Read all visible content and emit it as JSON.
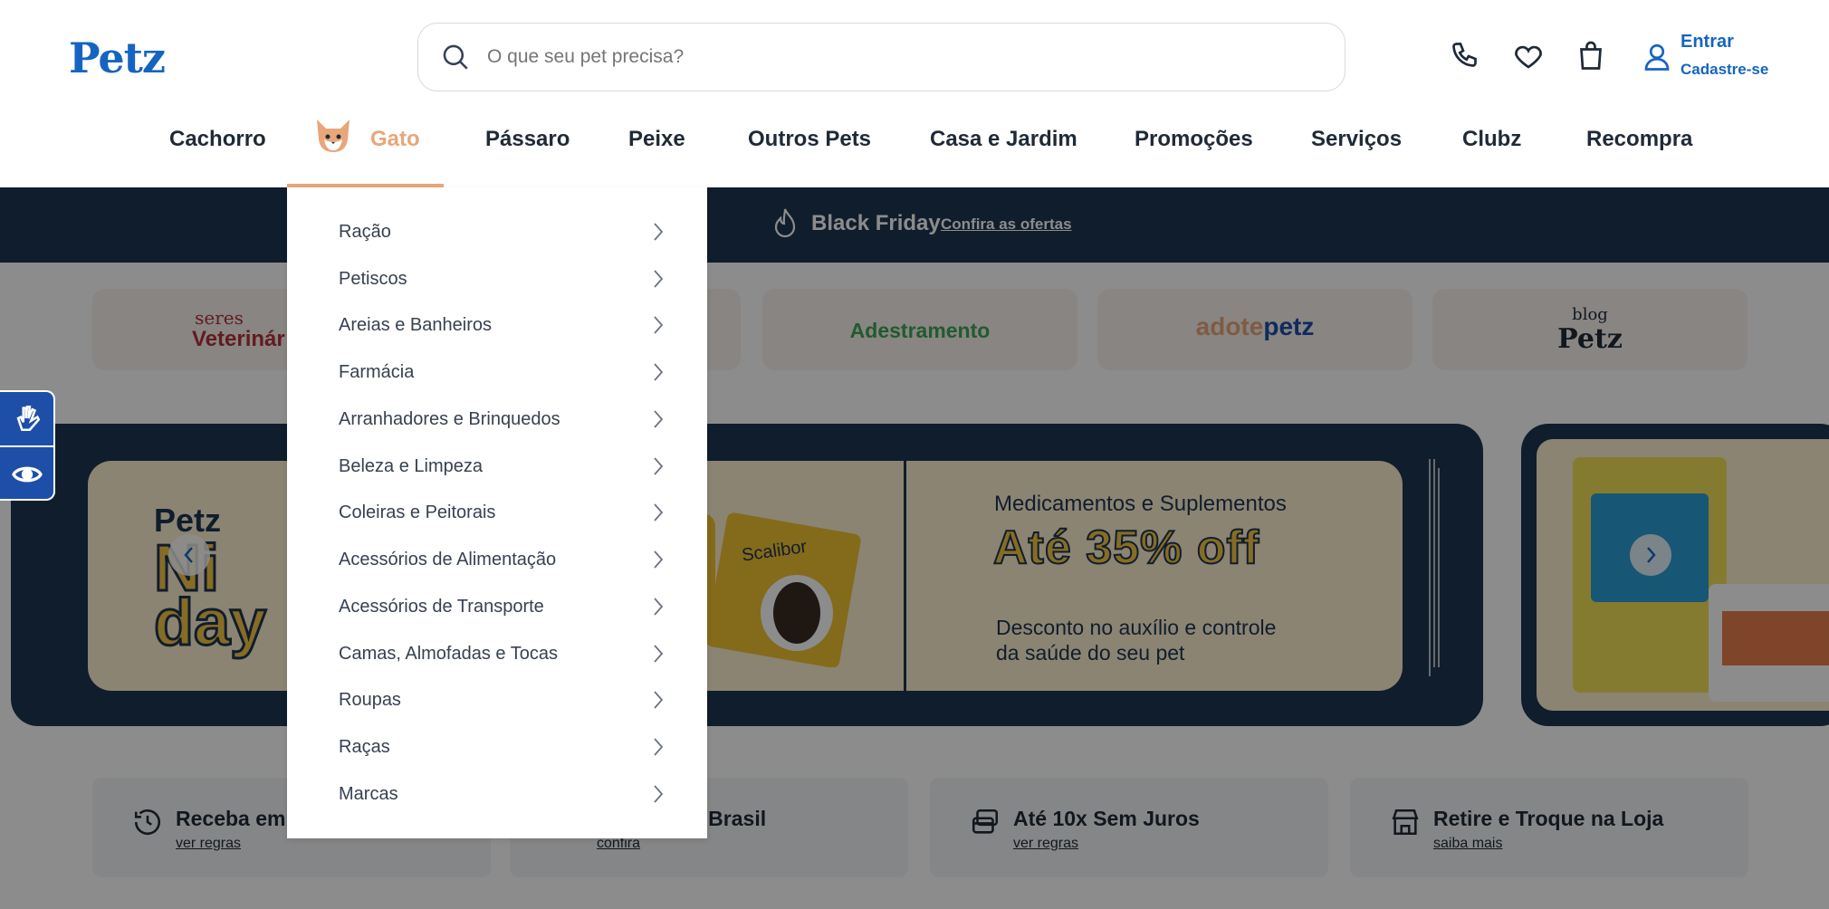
{
  "header": {
    "search_placeholder": "O que seu pet precisa?",
    "login_label": "Entrar",
    "signup_label": "Cadastre-se"
  },
  "nav": {
    "items": [
      {
        "label": "Cachorro"
      },
      {
        "label": "Gato"
      },
      {
        "label": "Pássaro"
      },
      {
        "label": "Peixe"
      },
      {
        "label": "Outros Pets"
      },
      {
        "label": "Casa e Jardim"
      },
      {
        "label": "Promoções"
      },
      {
        "label": "Serviços"
      },
      {
        "label": "Clubz"
      },
      {
        "label": "Recompra"
      }
    ],
    "active": "Gato"
  },
  "dropdown": {
    "items": [
      "Ração",
      "Petiscos",
      "Areias e Banheiros",
      "Farmácia",
      "Arranhadores e Brinquedos",
      "Beleza e Limpeza",
      "Coleiras e Peitorais",
      "Acessórios de Alimentação",
      "Acessórios de Transporte",
      "Camas, Almofadas e Tocas",
      "Roupas",
      "Raças",
      "Marcas"
    ]
  },
  "promo_bar": {
    "title": "Black Friday",
    "link": "Confira as ofertas"
  },
  "partners": {
    "seres_line1": "seres",
    "seres_line2": "Veterinár",
    "adestramento": "Adestramento",
    "adote_a": "adote",
    "adote_b": "petz",
    "blog_top": "blog",
    "blog_bottom": "Petz"
  },
  "banner": {
    "category": "Medicamentos e Suplementos",
    "offer": "Até 35% off",
    "desc_line1": "Desconto no auxílio e controle",
    "desc_line2": "da saúde do seu pet",
    "brand": "Petz",
    "day_line1": "Ni",
    "day_line2": "day",
    "product_name": "Scalibor"
  },
  "features": [
    {
      "title": "Receba em",
      "link": "ver regras"
    },
    {
      "title": "s Brasil",
      "link": "confira"
    },
    {
      "title": "Até 10x Sem Juros",
      "link": "ver regras"
    },
    {
      "title": "Retire e Troque na Loja",
      "link": "saiba mais"
    }
  ],
  "colors": {
    "brand_blue": "#1565c0",
    "active_nav": "#e8a67b",
    "navy": "#1e3551",
    "offer_yellow": "#f4c542"
  }
}
